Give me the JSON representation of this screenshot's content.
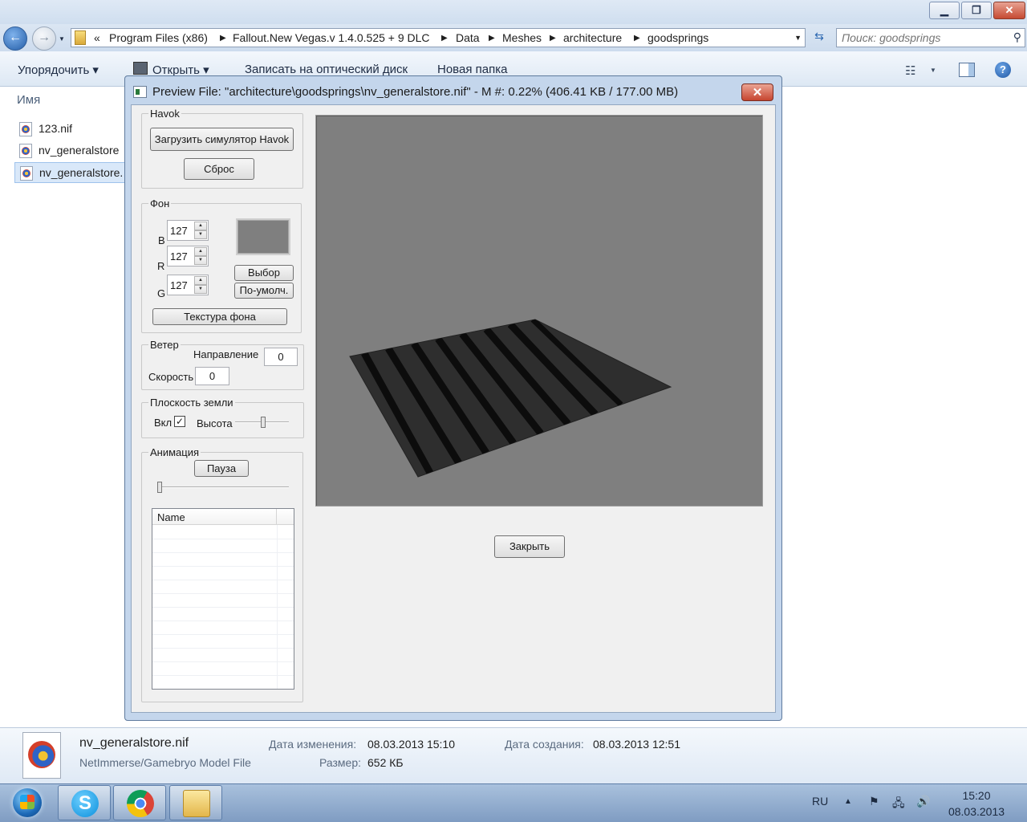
{
  "explorer": {
    "breadcrumbs": [
      "«",
      "Program Files (x86)",
      "Fallout.New Vegas.v 1.4.0.525 + 9 DLC",
      "Data",
      "Meshes",
      "architecture",
      "goodsprings"
    ],
    "search_placeholder": "Поиск: goodsprings",
    "toolbar": {
      "organize": "Упорядочить ▾",
      "open": "Открыть ▾",
      "burn": "Записать на оптический диск",
      "new_folder": "Новая папка"
    },
    "column_name": "Имя",
    "files": [
      {
        "name": "123.nif"
      },
      {
        "name": "nv_generalstore"
      },
      {
        "name": "nv_generalstore."
      }
    ],
    "details": {
      "file_name": "nv_generalstore.nif",
      "file_type": "NetImmerse/Gamebryo Model File",
      "modified_label": "Дата изменения:",
      "modified_value": "08.03.2013 15:10",
      "size_label": "Размер:",
      "size_value": "652 КБ",
      "created_label": "Дата создания:",
      "created_value": "08.03.2013 12:51"
    }
  },
  "dialog": {
    "title": "Preview File: \"architecture\\goodsprings\\nv_generalstore.nif\" - M #: 0.22% (406.41 KB / 177.00 MB)",
    "close_glyph": "✕",
    "havok": {
      "label": "Havok",
      "load_button": "Загрузить симулятор Havok",
      "reset_button": "Сброс"
    },
    "background": {
      "label": "Фон",
      "b_label": "B",
      "r_label": "R",
      "g_label": "G",
      "b_value": "127",
      "r_value": "127",
      "g_value": "127",
      "swatch_color": "#7f7f7f",
      "choose_button": "Выбор",
      "default_button": "По-умолч.",
      "texture_button": "Текстура фона"
    },
    "wind": {
      "label": "Ветер",
      "direction_label": "Направление",
      "direction_value": "0",
      "speed_label": "Скорость",
      "speed_value": "0"
    },
    "ground": {
      "label": "Плоскость земли",
      "on_label": "Вкл",
      "checked": "✓",
      "height_label": "Высота"
    },
    "animation": {
      "label": "Анимация",
      "pause_button": "Пауза",
      "list_header": "Name"
    },
    "close_button": "Закрыть"
  },
  "taskbar": {
    "lang": "RU",
    "time": "15:20",
    "date": "08.03.2013"
  }
}
